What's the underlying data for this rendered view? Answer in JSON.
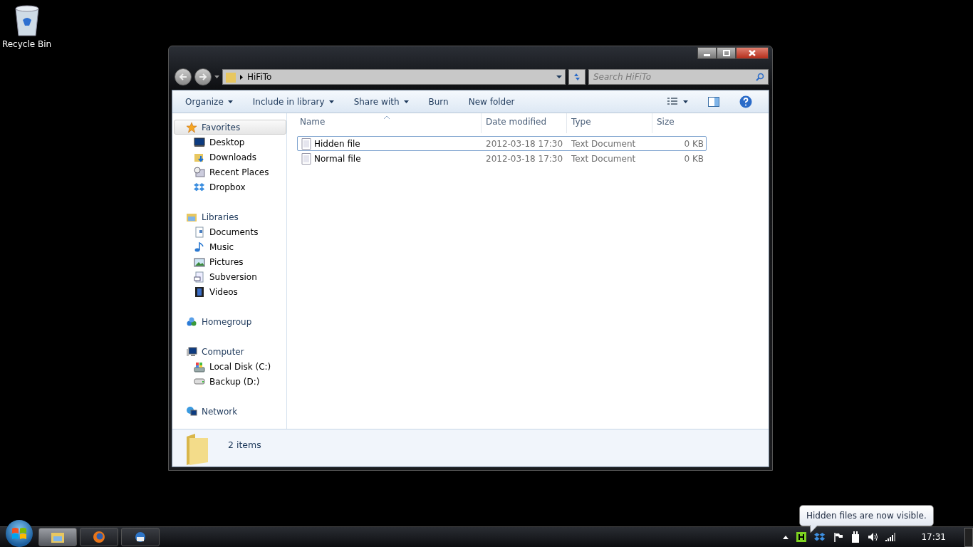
{
  "desktop_icons": [
    {
      "label": "Recycle Bin"
    }
  ],
  "window": {
    "address": {
      "path": "HiFiTo"
    },
    "search": {
      "placeholder": "Search HiFiTo"
    },
    "toolbar": [
      {
        "label": "Organize",
        "dropdown": true
      },
      {
        "label": "Include in library",
        "dropdown": true
      },
      {
        "label": "Share with",
        "dropdown": true
      },
      {
        "label": "Burn",
        "dropdown": false
      },
      {
        "label": "New folder",
        "dropdown": false
      }
    ],
    "nav": [
      {
        "label": "Favorites",
        "selected": true,
        "children": [
          {
            "label": "Desktop"
          },
          {
            "label": "Downloads"
          },
          {
            "label": "Recent Places"
          },
          {
            "label": "Dropbox"
          }
        ]
      },
      {
        "label": "Libraries",
        "selected": false,
        "children": [
          {
            "label": "Documents"
          },
          {
            "label": "Music"
          },
          {
            "label": "Pictures"
          },
          {
            "label": "Subversion"
          },
          {
            "label": "Videos"
          }
        ]
      },
      {
        "label": "Homegroup",
        "selected": false
      },
      {
        "label": "Computer",
        "selected": false,
        "children": [
          {
            "label": "Local Disk (C:)"
          },
          {
            "label": "Backup (D:)"
          }
        ]
      },
      {
        "label": "Network",
        "selected": false
      }
    ],
    "columns": [
      {
        "label": "Name",
        "sorted": true
      },
      {
        "label": "Date modified",
        "sorted": false
      },
      {
        "label": "Type",
        "sorted": false
      },
      {
        "label": "Size",
        "sorted": false
      }
    ],
    "rows": [
      {
        "name": "Hidden file",
        "date": "2012-03-18 17:30",
        "type": "Text Document",
        "size": "0 KB",
        "focused": true
      },
      {
        "name": "Normal file",
        "date": "2012-03-18 17:30",
        "type": "Text Document",
        "size": "0 KB",
        "focused": false
      }
    ],
    "status": "2 items"
  },
  "taskbar": {
    "apps": [
      {
        "kind": "explorer",
        "active": true
      },
      {
        "kind": "firefox",
        "active": false
      },
      {
        "kind": "thunderbird",
        "active": false
      }
    ],
    "clock": "17:31"
  },
  "tooltip": "Hidden files are now visible."
}
